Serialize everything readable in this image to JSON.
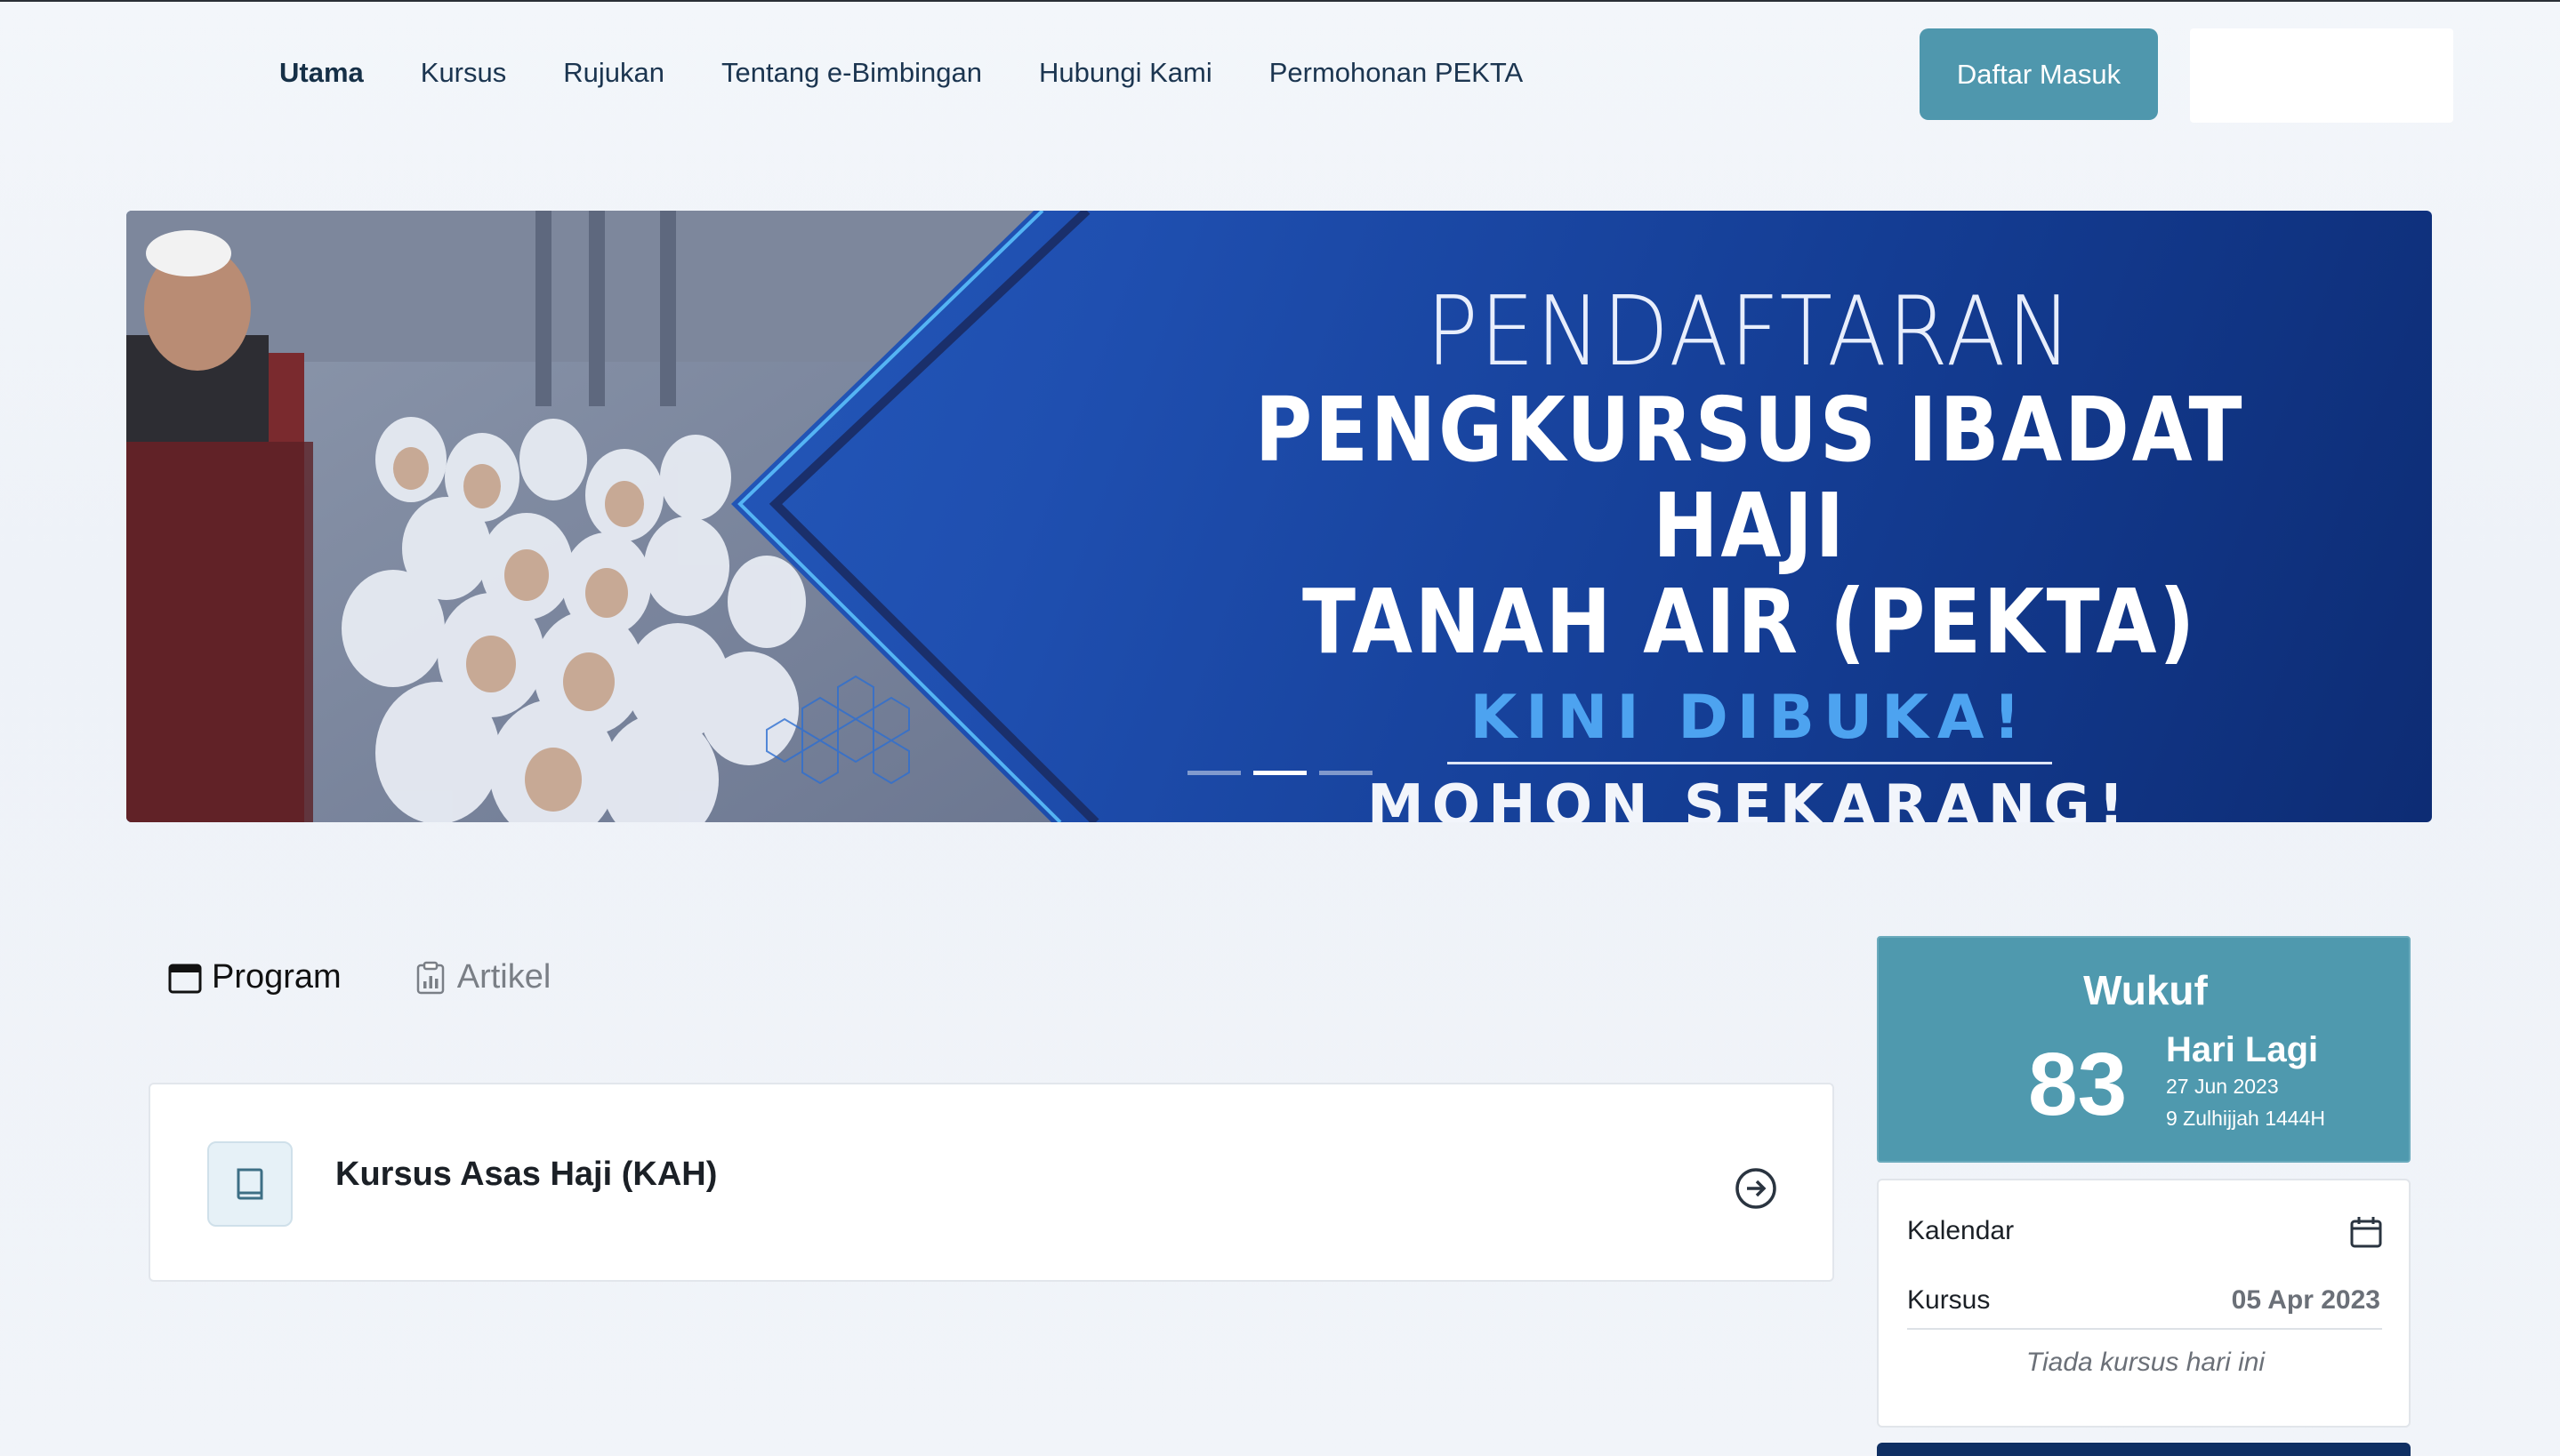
{
  "nav": {
    "items": [
      {
        "label": "Utama",
        "active": true
      },
      {
        "label": "Kursus",
        "active": false
      },
      {
        "label": "Rujukan",
        "active": false
      },
      {
        "label": "Tentang e-Bimbingan",
        "active": false
      },
      {
        "label": "Hubungi Kami",
        "active": false
      },
      {
        "label": "Permohonan PEKTA",
        "active": false
      }
    ],
    "login_label": "Daftar Masuk"
  },
  "banner": {
    "line1": "PENDAFTARAN",
    "line2": "PENGKURSUS IBADAT HAJI",
    "line3": "TANAH AIR (PEKTA)",
    "line4": "KINI DIBUKA!",
    "line5": "MOHON SEKARANG!",
    "slides_total": 3,
    "active_slide": 2
  },
  "tabs": [
    {
      "label": "Program",
      "icon": "calendar-icon",
      "active": true
    },
    {
      "label": "Artikel",
      "icon": "clipboard-chart-icon",
      "active": false
    }
  ],
  "program": {
    "title": "Kursus Asas Haji (KAH)",
    "icon": "book-icon",
    "action_icon": "arrow-right-circle-icon"
  },
  "wukuf": {
    "title": "Wukuf",
    "days": "83",
    "days_label": "Hari Lagi",
    "gregorian_date": "27 Jun 2023",
    "hijri_date": "9 Zulhijjah 1444H"
  },
  "calendar": {
    "title": "Kalendar",
    "kursus_label": "Kursus",
    "date": "05 Apr 2023",
    "empty_text": "Tiada kursus hari ini"
  },
  "colors": {
    "accent": "#4f97ad",
    "banner_blue": "#1f4fb0",
    "highlight_blue": "#4da3f0"
  }
}
